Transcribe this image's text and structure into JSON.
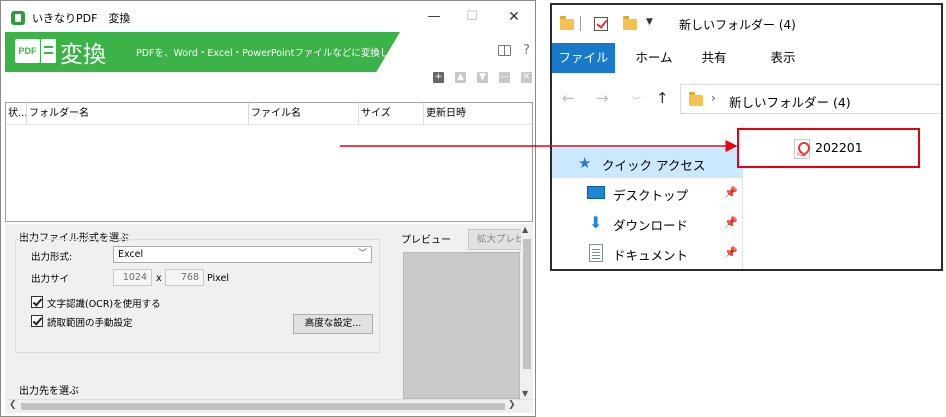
{
  "left_window": {
    "title": "いきなりPDF　変換",
    "controls": {
      "minimize": "—",
      "maximize": "☐",
      "close": "✕"
    },
    "banner": {
      "logo_text": "PDF",
      "title": "変換",
      "description": "PDFを、Word・Excel・PowerPointファイルなどに変換します",
      "help": "?"
    },
    "toolbar_buttons": [
      "+",
      "▲",
      "▼",
      "—",
      "✕"
    ],
    "list_columns": [
      "状...",
      "フォルダー名",
      "ファイル名",
      "サイズ",
      "更新日時"
    ],
    "format_section": {
      "title": "出力ファイル形式を選ぶ",
      "format_label": "出力形式:",
      "format_value": "Excel",
      "size_label": "出力サイ",
      "width": "1024",
      "x": "x",
      "height": "768",
      "unit": "Pixel",
      "ocr_label": "文字認識(OCR)を使用する",
      "manual_range_label": "読取範囲の手動設定",
      "advanced_button": "高度な設定..."
    },
    "preview": {
      "label": "プレビュー",
      "zoom_button": "拡大プレビ"
    },
    "destination_section": {
      "title": "出力先を選ぶ"
    }
  },
  "right_window": {
    "title": "新しいフォルダー (4)",
    "ribbon_tabs": [
      "ファイル",
      "ホーム",
      "共有",
      "表示"
    ],
    "address": "新しいフォルダー (4)",
    "nav_items": [
      {
        "label": "クイック アクセス",
        "icon": "star-icon",
        "selected": true
      },
      {
        "label": "デスクトップ",
        "icon": "desktop-icon",
        "pinned": true
      },
      {
        "label": "ダウンロード",
        "icon": "download-icon",
        "pinned": true
      },
      {
        "label": "ドキュメント",
        "icon": "document-icon",
        "pinned": true
      }
    ],
    "file": {
      "name": "202201",
      "icon": "pdf-file-icon"
    }
  },
  "colors": {
    "banner_green": "#3cb349",
    "ribbon_file_blue": "#1979ca",
    "highlight_red": "#e60012",
    "nav_selected": "#cce8ff"
  }
}
